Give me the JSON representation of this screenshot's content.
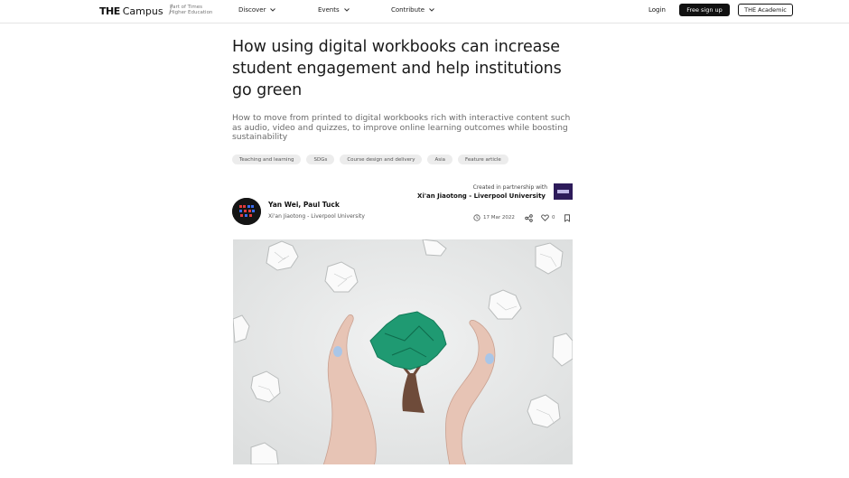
{
  "header": {
    "logo_the": "THE",
    "logo_campus": "Campus",
    "logo_part_line1": "Part of Times",
    "logo_part_line2": "Higher Education",
    "nav": [
      {
        "label": "Discover"
      },
      {
        "label": "Events"
      },
      {
        "label": "Contribute"
      }
    ],
    "login_label": "Login",
    "signup_label": "Free sign up",
    "academic_label": "THE Academic"
  },
  "article": {
    "title": "How using digital workbooks can increase student engagement and help institutions go green",
    "standfirst": "How to move from printed to digital workbooks rich with interactive content such as audio, video and quizzes, to improve online learning outcomes while boosting sustainability",
    "tags": [
      "Teaching and learning",
      "SDGs",
      "Course design and delivery",
      "Asia",
      "Feature article"
    ],
    "partner_label": "Created in partnership with",
    "partner_name": "Xi'an Jiaotong - Liverpool University",
    "authors": "Yan Wei, Paul Tuck",
    "affiliation": "Xi'an Jiaotong - Liverpool University",
    "date": "17 Mar 2022",
    "likes": "0"
  },
  "colors": {
    "accent": "#111111",
    "partner_logo": "#2d1b5a",
    "tree": "#1f9a72",
    "hero_bg": "#e9eaea"
  },
  "icons": [
    "chevron-down-icon",
    "clock-icon",
    "share-icon",
    "heart-icon",
    "bookmark-icon"
  ]
}
